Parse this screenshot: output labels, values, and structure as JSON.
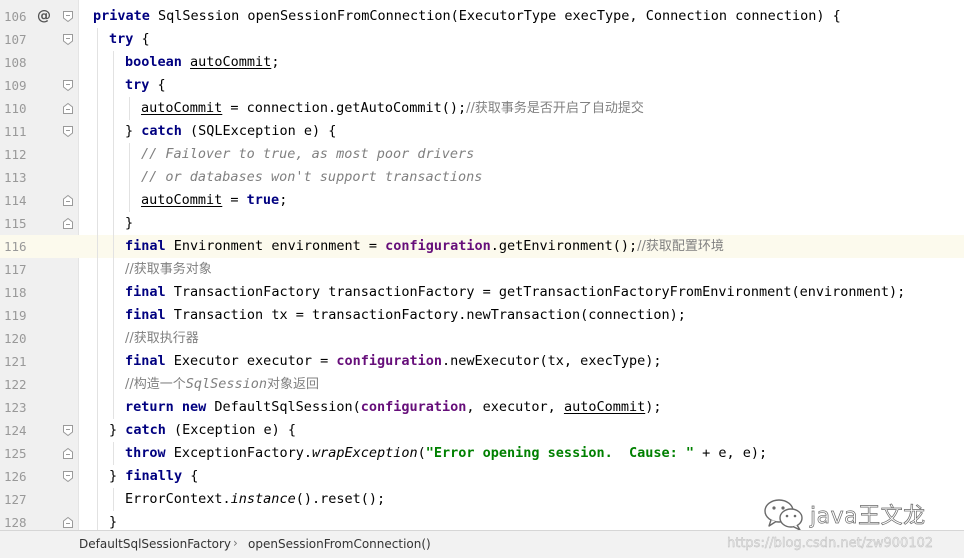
{
  "editor": {
    "lines": [
      {
        "number": "106",
        "marker": "@",
        "tokens": [
          {
            "t": "private ",
            "c": "kw"
          },
          {
            "t": "SqlSession openSessionFromConnection(ExecutorType execType, Connection connection) {"
          }
        ]
      },
      {
        "number": "107",
        "tokens": [
          {
            "t": "try ",
            "c": "kw"
          },
          {
            "t": "{"
          }
        ]
      },
      {
        "number": "108",
        "tokens": [
          {
            "t": "boolean ",
            "c": "kw"
          },
          {
            "t": "autoCommit",
            "c": "u"
          },
          {
            "t": ";"
          }
        ]
      },
      {
        "number": "109",
        "tokens": [
          {
            "t": "try ",
            "c": "kw"
          },
          {
            "t": "{"
          }
        ]
      },
      {
        "number": "110",
        "tokens": [
          {
            "t": "autoCommit",
            "c": "u"
          },
          {
            "t": " = connection.getAutoCommit();"
          },
          {
            "t": "//获取事务是否开启了自动提交",
            "c": "cn-comment"
          }
        ]
      },
      {
        "number": "111",
        "tokens": [
          {
            "t": "} "
          },
          {
            "t": "catch ",
            "c": "kw"
          },
          {
            "t": "(SQLException e) {"
          }
        ]
      },
      {
        "number": "112",
        "tokens": [
          {
            "t": "// Failover to true, as most poor drivers",
            "c": "comment"
          }
        ]
      },
      {
        "number": "113",
        "tokens": [
          {
            "t": "// or databases won't support transactions",
            "c": "comment"
          }
        ]
      },
      {
        "number": "114",
        "tokens": [
          {
            "t": "autoCommit",
            "c": "u"
          },
          {
            "t": " = "
          },
          {
            "t": "true",
            "c": "kw"
          },
          {
            "t": ";"
          }
        ]
      },
      {
        "number": "115",
        "tokens": [
          {
            "t": "}"
          }
        ]
      },
      {
        "number": "116",
        "current": true,
        "tokens": [
          {
            "t": "final ",
            "c": "kw"
          },
          {
            "t": "Environment environment = "
          },
          {
            "t": "configuration",
            "c": "field"
          },
          {
            "t": ".getEnvironment();"
          },
          {
            "t": "//获取配置环境",
            "c": "cn-comment"
          }
        ]
      },
      {
        "number": "117",
        "tokens": [
          {
            "t": "//获取事务对象",
            "c": "cn-comment"
          }
        ]
      },
      {
        "number": "118",
        "tokens": [
          {
            "t": "final ",
            "c": "kw"
          },
          {
            "t": "TransactionFactory transactionFactory = getTransactionFactoryFromEnvironment(environment);"
          }
        ]
      },
      {
        "number": "119",
        "tokens": [
          {
            "t": "final ",
            "c": "kw"
          },
          {
            "t": "Transaction tx = transactionFactory.newTransaction(connection);"
          }
        ]
      },
      {
        "number": "120",
        "tokens": [
          {
            "t": "//获取执行器",
            "c": "cn-comment"
          }
        ]
      },
      {
        "number": "121",
        "tokens": [
          {
            "t": "final ",
            "c": "kw"
          },
          {
            "t": "Executor executor = "
          },
          {
            "t": "configuration",
            "c": "field"
          },
          {
            "t": ".newExecutor(tx, execType);"
          }
        ]
      },
      {
        "number": "122",
        "tokens": [
          {
            "t": "//构造一个",
            "c": "cn-comment"
          },
          {
            "t": "SqlSession",
            "c": "comment"
          },
          {
            "t": "对象返回",
            "c": "cn-comment"
          }
        ]
      },
      {
        "number": "123",
        "tokens": [
          {
            "t": "return new ",
            "c": "kw"
          },
          {
            "t": "DefaultSqlSession("
          },
          {
            "t": "configuration",
            "c": "field"
          },
          {
            "t": ", executor, "
          },
          {
            "t": "autoCommit",
            "c": "u"
          },
          {
            "t": ");"
          }
        ]
      },
      {
        "number": "124",
        "tokens": [
          {
            "t": "} "
          },
          {
            "t": "catch ",
            "c": "kw"
          },
          {
            "t": "(Exception e) {"
          }
        ]
      },
      {
        "number": "125",
        "tokens": [
          {
            "t": "throw ",
            "c": "kw"
          },
          {
            "t": "ExceptionFactory."
          },
          {
            "t": "wrapException",
            "c": "ital"
          },
          {
            "t": "("
          },
          {
            "t": "\"Error opening session.  Cause: \"",
            "c": "str"
          },
          {
            "t": " + e, e);"
          }
        ]
      },
      {
        "number": "126",
        "tokens": [
          {
            "t": "} "
          },
          {
            "t": "finally ",
            "c": "kw"
          },
          {
            "t": "{"
          }
        ]
      },
      {
        "number": "127",
        "tokens": [
          {
            "t": "ErrorContext."
          },
          {
            "t": "instance",
            "c": "ital"
          },
          {
            "t": "().reset();"
          }
        ]
      },
      {
        "number": "128",
        "tokens": [
          {
            "t": "}"
          }
        ]
      }
    ]
  },
  "breadcrumb": {
    "class_name": "DefaultSqlSessionFactory",
    "separator": "›",
    "method_name": "openSessionFromConnection()"
  },
  "watermark": {
    "name": "java王文龙",
    "url": "https://blog.csdn.net/zw900102"
  }
}
